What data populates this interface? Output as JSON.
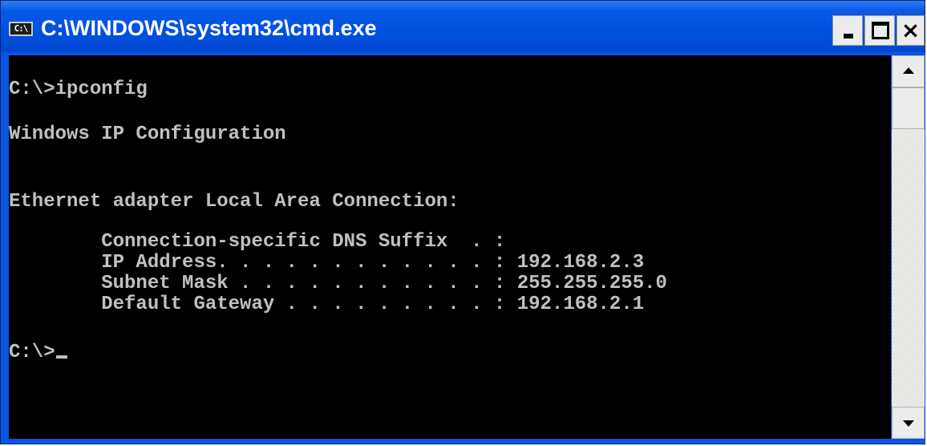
{
  "window": {
    "title": "C:\\WINDOWS\\system32\\cmd.exe",
    "icon_text": "C:\\",
    "icon": "console-app-icon"
  },
  "controls": {
    "minimize_icon": "minimize-icon",
    "maximize_icon": "maximize-icon",
    "close_label": "×"
  },
  "console": {
    "lines": [
      "C:\\>ipconfig",
      "Windows IP Configuration",
      "Ethernet adapter Local Area Connection:",
      "        Connection-specific DNS Suffix  . :",
      "        IP Address. . . . . . . . . . . . : 192.168.2.3",
      "        Subnet Mask . . . . . . . . . . . : 255.255.255.0",
      "        Default Gateway . . . . . . . . . : 192.168.2.1",
      "C:\\>"
    ],
    "text_color": "#c0c0c0",
    "background_color": "#000000"
  },
  "scrollbar": {
    "up_icon": "scroll-up-arrow-icon",
    "down_icon": "scroll-down-arrow-icon"
  },
  "colors": {
    "titlebar": "#0050e0",
    "title_text": "#ffffff"
  }
}
